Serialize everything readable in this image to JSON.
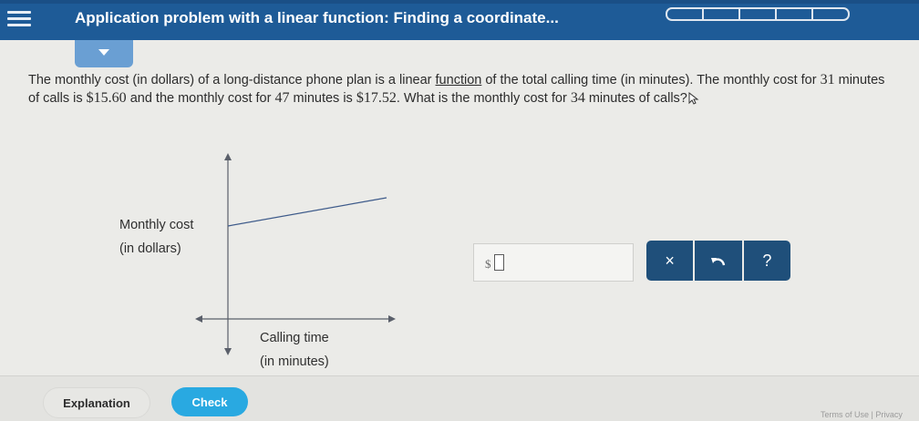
{
  "header": {
    "title": "Application problem with a linear function: Finding a coordinate...",
    "progress_segments": 5,
    "menu_icon": "hamburger-menu-icon",
    "colors": {
      "bar": "#1e5b97",
      "dropdown": "#6a9fd3"
    }
  },
  "question": {
    "part1": "The monthly cost (in dollars) of a long-distance phone plan is a linear ",
    "link": "function",
    "part2": " of the total calling time (in minutes). The monthly cost for ",
    "v1": "31",
    "part3": " minutes of calls is ",
    "v2": "$15.60",
    "part4": " and the monthly cost for ",
    "v3": "47",
    "part5": " minutes is ",
    "v4": "$17.52",
    "part6": ". What is the monthly cost for ",
    "v5": "34",
    "part7": " minutes of calls?"
  },
  "graph": {
    "y_label_line1": "Monthly cost",
    "y_label_line2": "(in dollars)",
    "x_label_line1": "Calling time",
    "x_label_line2": "(in minutes)"
  },
  "answer": {
    "prefix": "$",
    "value": ""
  },
  "tools": {
    "clear": "×",
    "undo_icon": "undo-icon",
    "help": "?",
    "color": "#1f4f7a"
  },
  "footer": {
    "explanation": "Explanation",
    "check": "Check",
    "check_color": "#29a9e1",
    "links": "Terms of Use  |  Privacy"
  }
}
